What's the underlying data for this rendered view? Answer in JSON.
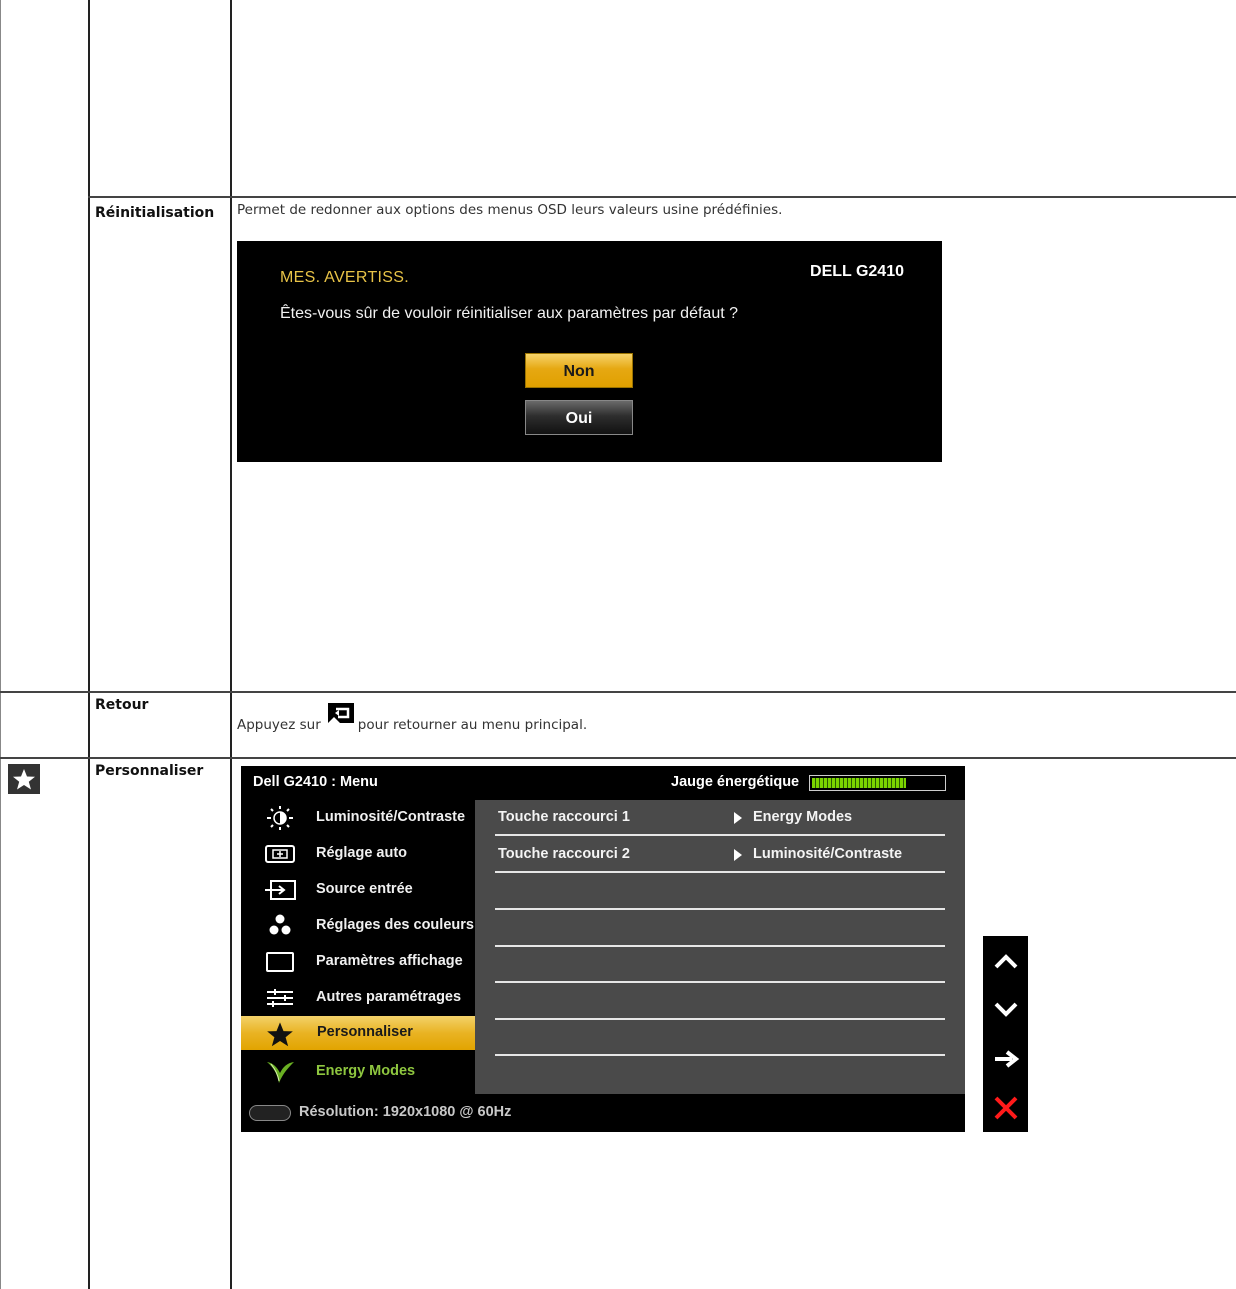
{
  "reinit": {
    "label": "Réinitialisation",
    "description": "Permet de redonner aux options des menus OSD leurs valeurs usine prédéfinies.",
    "dialog": {
      "warning": "MES. AVERTISS.",
      "brand": "DELL G2410",
      "question": "Êtes-vous sûr de vouloir réinitialiser aux paramètres par défaut ?",
      "btn_no": "Non",
      "btn_yes": "Oui"
    }
  },
  "retour": {
    "label": "Retour",
    "text_before": "Appuyez sur",
    "text_after": "pour retourner au menu principal."
  },
  "personnaliser": {
    "label": "Personnaliser",
    "osd": {
      "title": "Dell G2410 : Menu",
      "gauge_label": "Jauge énergétique",
      "gauge_level": 0.72,
      "menu": [
        {
          "label": "Luminosité/Contraste",
          "icon": "brightness-icon"
        },
        {
          "label": "Réglage auto",
          "icon": "auto-adjust-icon"
        },
        {
          "label": "Source entrée",
          "icon": "input-source-icon"
        },
        {
          "label": "Réglages des couleurs",
          "icon": "color-settings-icon"
        },
        {
          "label": "Paramètres affichage",
          "icon": "display-settings-icon"
        },
        {
          "label": "Autres paramétrages",
          "icon": "other-settings-icon"
        },
        {
          "label": "Personnaliser",
          "icon": "star-icon"
        },
        {
          "label": "Energy Modes",
          "icon": "leaf-icon"
        }
      ],
      "rows": [
        {
          "key": "Touche raccourci 1",
          "value": "Energy Modes"
        },
        {
          "key": "Touche raccourci 2",
          "value": "Luminosité/Contraste"
        },
        {
          "key": "",
          "value": ""
        },
        {
          "key": "",
          "value": ""
        },
        {
          "key": "",
          "value": ""
        },
        {
          "key": "",
          "value": ""
        }
      ],
      "resolution": "Résolution: 1920x1080 @ 60Hz"
    },
    "nav": {
      "up": "⌃",
      "down": "⌄",
      "enter": "→",
      "exit": "✕"
    }
  },
  "colors": {
    "osd_gold": "#e6a812",
    "osd_panel": "#4a4a4a",
    "energy_green": "#8ec63f",
    "exit_red": "#ff1a1a"
  }
}
